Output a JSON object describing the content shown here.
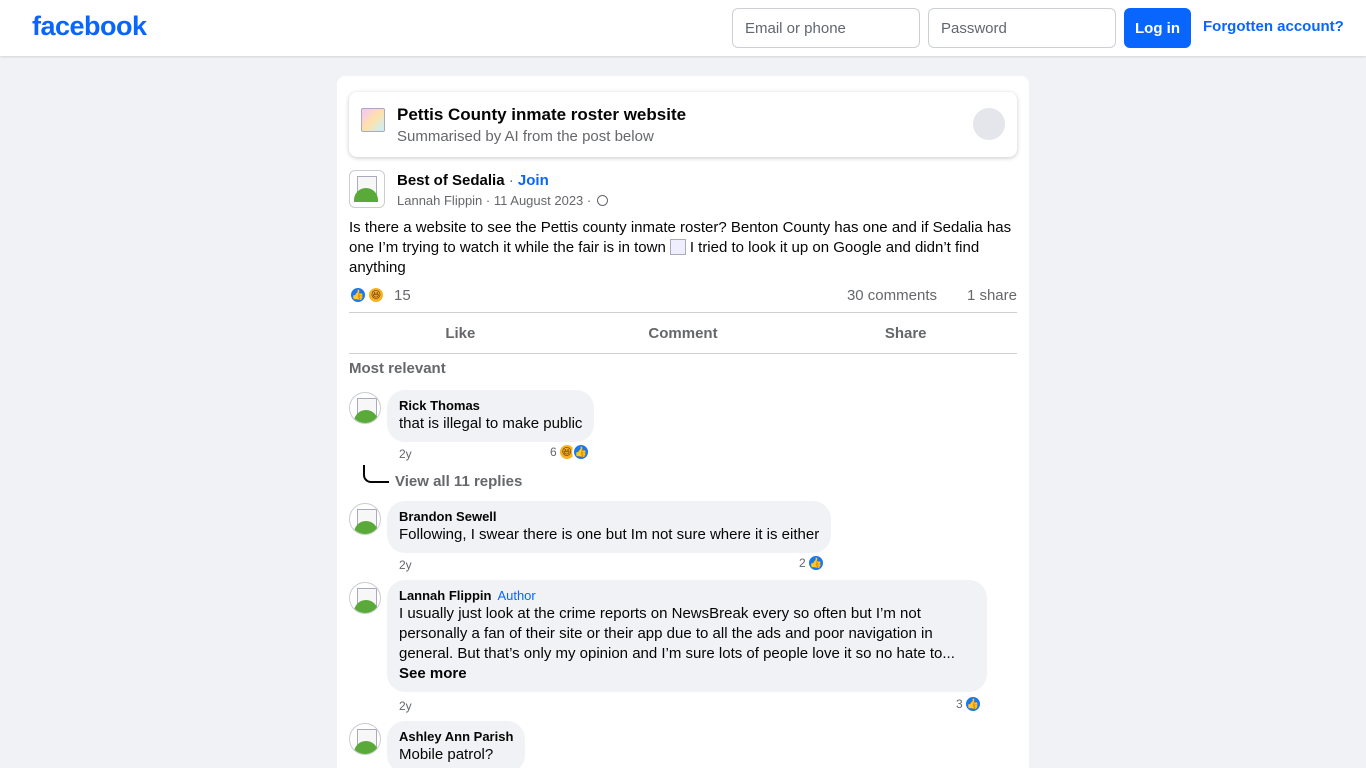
{
  "header": {
    "logo": "facebook",
    "email_placeholder": "Email or phone",
    "password_placeholder": "Password",
    "login_label": "Log in",
    "forgot_label": "Forgotten account?"
  },
  "ai_summary": {
    "title": "Pettis County inmate roster website",
    "subtitle": "Summarised by AI from the post below"
  },
  "post": {
    "group_name": "Best of Sedalia",
    "separator": "·",
    "join_label": "Join",
    "author": "Lannah Flippin",
    "date": "11 August 2023",
    "text_part1": "Is there a website to see the Pettis county inmate roster? Benton County has one and if Sedalia has one I’m trying to watch it while the fair is in town",
    "text_part2": "I tried to look it up on Google and didn’t find anything",
    "reaction_count": "15",
    "comments_count": "30 comments",
    "shares_count": "1 share"
  },
  "actions": {
    "like": "Like",
    "comment": "Comment",
    "share": "Share"
  },
  "comments_header": "Most relevant",
  "comments": [
    {
      "name": "Rick Thomas",
      "text": "that is illegal to make public",
      "time": "2y",
      "reactions": "6"
    },
    {
      "name": "Brandon Sewell",
      "text": "Following, I swear there is one but Im not sure where it is either",
      "time": "2y",
      "reactions": "2"
    },
    {
      "name": "Lannah Flippin",
      "badge": "Author",
      "text": "I usually just look at the crime reports on NewsBreak every so often but I’m not personally a fan of their site or their app due to all the ads and poor navigation in general. But that’s only my opinion and I’m sure lots of people love it so no hate to...",
      "see_more": "See more",
      "time": "2y",
      "reactions": "3"
    },
    {
      "name": "Ashley Ann Parish",
      "text": "Mobile patrol?"
    }
  ],
  "view_replies": "View all 11 replies",
  "colors": {
    "brand": "#0866ff",
    "background": "#f0f2f5",
    "secondary_text": "#65676b"
  }
}
